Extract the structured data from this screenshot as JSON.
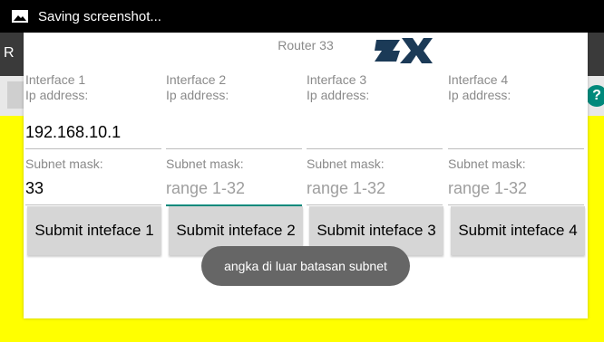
{
  "statusbar": {
    "notification_text": "Saving screenshot...",
    "icon": "image-icon"
  },
  "appbar": {
    "partial_letter": "R"
  },
  "dialog": {
    "title": "Router 33",
    "logo": "zx-logo",
    "interfaces": [
      {
        "header": "Interface 1",
        "ip_label": "Ip address:",
        "ip_value": "192.168.10.1",
        "subnet_label": "Subnet mask:",
        "subnet_value": "33",
        "subnet_placeholder": "",
        "button_label": "Submit inteface 1"
      },
      {
        "header": "Interface 2",
        "ip_label": "Ip address:",
        "ip_value": "",
        "subnet_label": "Subnet mask:",
        "subnet_value": "",
        "subnet_placeholder": "range 1-32",
        "button_label": "Submit inteface 2"
      },
      {
        "header": "Interface 3",
        "ip_label": "Ip address:",
        "ip_value": "",
        "subnet_label": "Subnet mask:",
        "subnet_value": "",
        "subnet_placeholder": "range 1-32",
        "button_label": "Submit inteface 3"
      },
      {
        "header": "Interface 4",
        "ip_label": "Ip address:",
        "ip_value": "",
        "subnet_label": "Subnet mask:",
        "subnet_value": "",
        "subnet_placeholder": "range 1-32",
        "button_label": "Submit inteface 4"
      }
    ]
  },
  "toast": {
    "text": "angka di luar batasan subnet"
  },
  "colors": {
    "accent": "#00897b",
    "background": "#ffff00"
  }
}
